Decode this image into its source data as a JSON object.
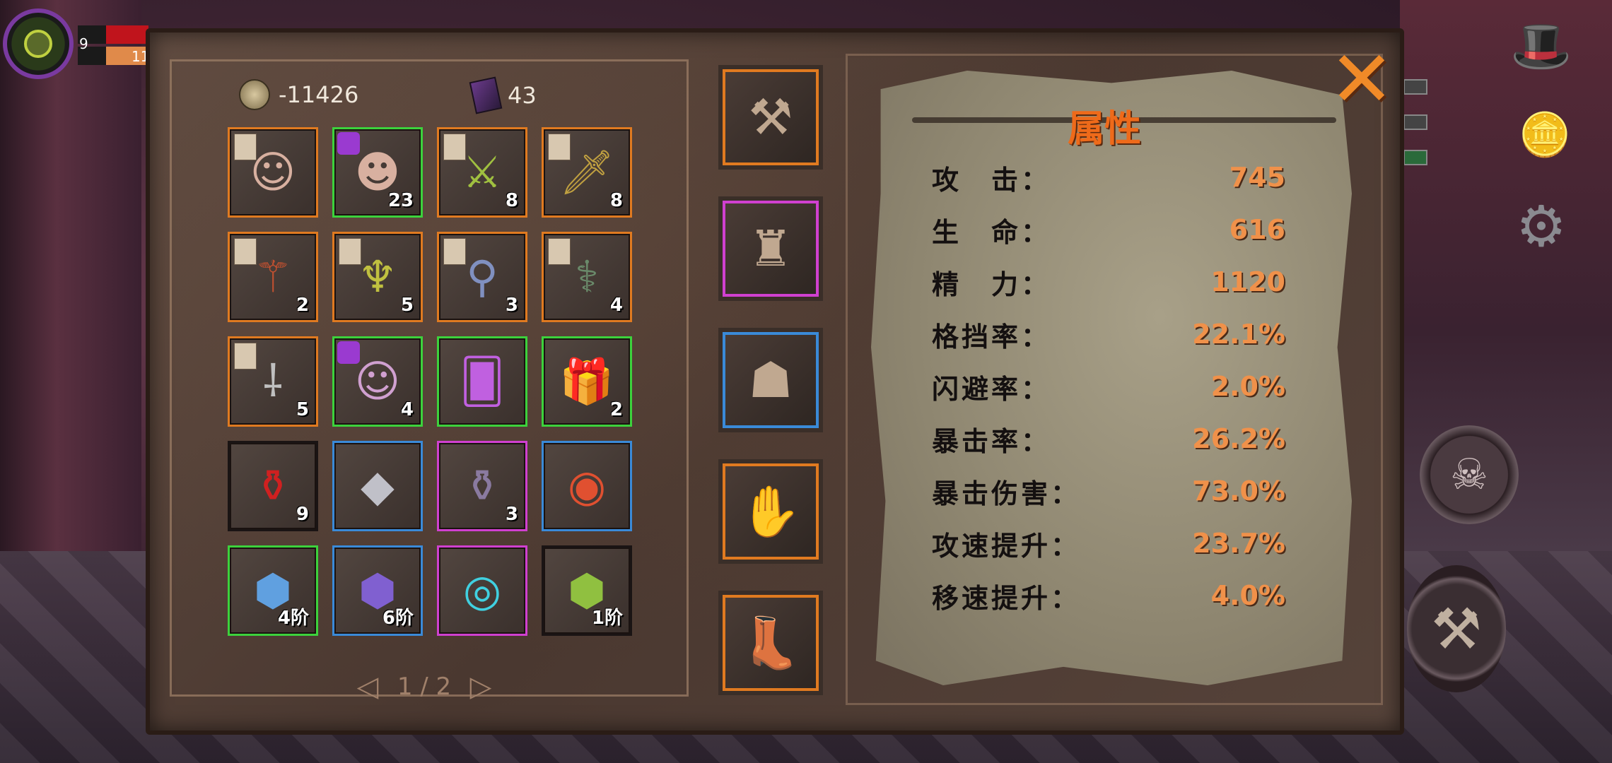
{
  "hud": {
    "level": "9",
    "resource_value": "11"
  },
  "currency": {
    "coins": "-11426",
    "books": "43"
  },
  "inventory": [
    {
      "name": "hero-portrait-santa",
      "icon": "hero-icon",
      "rarity": "orange",
      "count": "",
      "cls": "i-hero",
      "glyph": "☺",
      "tag": "scroll"
    },
    {
      "name": "hero-shard-white-hair",
      "icon": "hero-shard-icon",
      "rarity": "green",
      "count": "23",
      "cls": "i-hero",
      "glyph": "☻",
      "tag": "puzzle"
    },
    {
      "name": "weapon-green-sword",
      "icon": "sword-icon",
      "rarity": "orange",
      "count": "8",
      "cls": "i-weapon",
      "glyph": "⚔",
      "tag": "scroll"
    },
    {
      "name": "weapon-golden-blade",
      "icon": "blade-icon",
      "rarity": "orange",
      "count": "8",
      "cls": "i-weapon2",
      "glyph": "🗡",
      "tag": "scroll"
    },
    {
      "name": "weapon-red-staff",
      "icon": "staff-icon",
      "rarity": "orange",
      "count": "2",
      "cls": "i-staff",
      "glyph": "⚚",
      "tag": "scroll"
    },
    {
      "name": "weapon-trident",
      "icon": "trident-icon",
      "rarity": "orange",
      "count": "5",
      "cls": "i-trident",
      "glyph": "♆",
      "tag": "scroll"
    },
    {
      "name": "weapon-orb-scepter",
      "icon": "scepter-icon",
      "rarity": "orange",
      "count": "3",
      "cls": "i-scepter",
      "glyph": "⚲",
      "tag": "scroll"
    },
    {
      "name": "weapon-eye-scepter",
      "icon": "scepter-icon",
      "rarity": "orange",
      "count": "4",
      "cls": "i-scepter2",
      "glyph": "⚕",
      "tag": "scroll"
    },
    {
      "name": "weapon-dark-blade",
      "icon": "blade-icon",
      "rarity": "orange",
      "count": "5",
      "cls": "i-blade",
      "glyph": "⸸",
      "tag": "scroll"
    },
    {
      "name": "hero-shard-girl",
      "icon": "hero-shard-icon",
      "rarity": "green",
      "count": "4",
      "cls": "i-girl",
      "glyph": "☺",
      "tag": "puzzle"
    },
    {
      "name": "card-purple-creature",
      "icon": "card-icon",
      "rarity": "green",
      "count": "",
      "cls": "i-card",
      "glyph": "🂠",
      "tag": ""
    },
    {
      "name": "gift-bell-box",
      "icon": "gift-icon",
      "rarity": "green",
      "count": "2",
      "cls": "i-gift",
      "glyph": "🎁",
      "tag": ""
    },
    {
      "name": "red-potion",
      "icon": "potion-icon",
      "rarity": "gray",
      "count": "9",
      "cls": "i-potion",
      "glyph": "⚱",
      "tag": ""
    },
    {
      "name": "gray-crystal",
      "icon": "crystal-icon",
      "rarity": "blue",
      "count": "",
      "cls": "i-crystal",
      "glyph": "◆",
      "tag": ""
    },
    {
      "name": "jar-of-orbs",
      "icon": "jar-icon",
      "rarity": "purple",
      "count": "3",
      "cls": "i-jar",
      "glyph": "⚱",
      "tag": ""
    },
    {
      "name": "dark-eye-relic",
      "icon": "eye-relic-icon",
      "rarity": "blue",
      "count": "",
      "cls": "i-eye",
      "glyph": "◉",
      "tag": ""
    },
    {
      "name": "rune-shield",
      "icon": "rune-icon",
      "rarity": "green",
      "count": "4阶",
      "cls": "i-rune1",
      "glyph": "⬢",
      "tag": ""
    },
    {
      "name": "rune-bird",
      "icon": "rune-icon",
      "rarity": "blue",
      "count": "6阶",
      "cls": "i-rune2",
      "glyph": "⬢",
      "tag": ""
    },
    {
      "name": "rune-portal",
      "icon": "rune-icon",
      "rarity": "purple",
      "count": "",
      "cls": "i-rune3",
      "glyph": "◎",
      "tag": ""
    },
    {
      "name": "rune-tree",
      "icon": "rune-icon",
      "rarity": "gray",
      "count": "1阶",
      "cls": "i-rune4",
      "glyph": "⬢",
      "tag": ""
    }
  ],
  "pager": {
    "text": "1 / 2"
  },
  "equipment": [
    {
      "name": "equip-weapon-scythe",
      "icon": "scythe-icon",
      "rarity": "orange",
      "glyph": "⚒"
    },
    {
      "name": "equip-armor-cloak",
      "icon": "cloak-icon",
      "rarity": "purple",
      "glyph": "♜"
    },
    {
      "name": "equip-helmet",
      "icon": "helmet-icon",
      "rarity": "blue",
      "glyph": "☗"
    },
    {
      "name": "equip-gauntlet",
      "icon": "gauntlet-icon",
      "rarity": "orange",
      "glyph": "✋"
    },
    {
      "name": "equip-boots",
      "icon": "boots-icon",
      "rarity": "orange",
      "glyph": "👢"
    }
  ],
  "stats": {
    "title": "属性",
    "rows": [
      {
        "label": "攻　击：",
        "value": "745"
      },
      {
        "label": "生　命：",
        "value": "616"
      },
      {
        "label": "精　力：",
        "value": "1120"
      },
      {
        "label": "格挡率：",
        "value": "22.1%"
      },
      {
        "label": "闪避率：",
        "value": "2.0%"
      },
      {
        "label": "暴击率：",
        "value": "26.2%"
      },
      {
        "label": "暴击伤害：",
        "value": "73.0%"
      },
      {
        "label": "攻速提升：",
        "value": "23.7%"
      },
      {
        "label": "移速提升：",
        "value": "4.0%"
      }
    ]
  },
  "colors": {
    "accent": "#ee6a1a",
    "rarity_orange": "#e07a20",
    "rarity_green": "#3cd23c",
    "rarity_blue": "#3a8ad8",
    "rarity_purple": "#d040d0"
  }
}
